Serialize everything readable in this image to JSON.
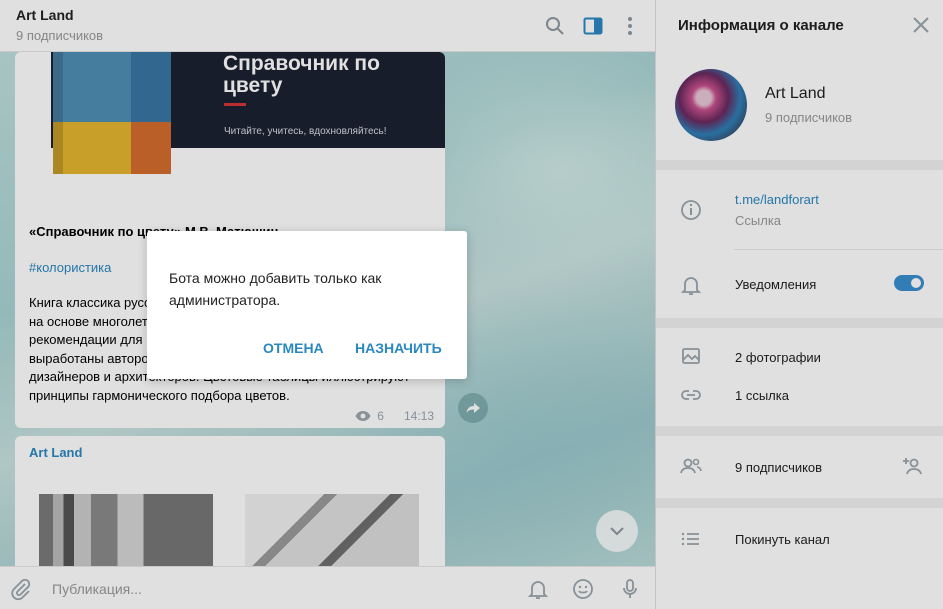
{
  "chat": {
    "title": "Art Land",
    "subtitle": "9 подписчиков",
    "icons": [
      "search-icon",
      "sidebar-toggle-icon",
      "more-vertical-icon"
    ]
  },
  "post1": {
    "cover_title": "Справочник по цвету",
    "cover_tagline": "Читайте, учитесь, вдохновляйтесь!",
    "caption": "«Справочник по цвету» М.В. Матюшин",
    "hashtag": "#колористика",
    "text": "Книга классика русского авангарда Михаила Матюшина написана на основе многолетних исследований цвета и формы. Выводы и рекомендации для их использования в художественной практике выработаны автором как практическое пособие для художников, дизайнеров и архитекторов. Цветовые таблицы иллюстрируют принципы гармонического подбора цветов.",
    "views": "6",
    "time": "14:13"
  },
  "post2": {
    "author": "Art Land"
  },
  "composer": {
    "placeholder": "Публикация..."
  },
  "info": {
    "title": "Информация о канале",
    "name": "Art Land",
    "subscribers": "9 подписчиков",
    "link": "t.me/landforart",
    "link_label": "Ссылка",
    "notifications_label": "Уведомления",
    "notifications_on": true,
    "photos": "2 фотографии",
    "links": "1 ссылка",
    "members": "9 подписчиков",
    "leave": "Покинуть канал"
  },
  "modal": {
    "message": "Бота можно добавить только как администратора.",
    "cancel_label": "ОТМЕНА",
    "confirm_label": "НАЗНАЧИТЬ"
  },
  "colors": {
    "accent": "#2a88c0",
    "toggle": "#3a8fd0",
    "chat_bg": "#a9d3d4"
  }
}
